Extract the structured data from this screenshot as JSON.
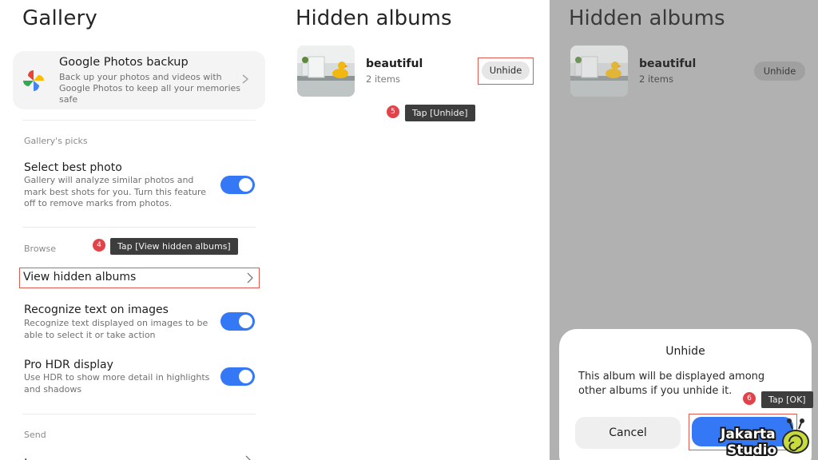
{
  "panel1": {
    "title": "Gallery",
    "backup": {
      "title": "Google Photos backup",
      "desc": "Back up your photos and videos with Google Photos to keep all your memories safe"
    },
    "picks_label": "Gallery's picks",
    "best_photo": {
      "title": "Select best photo",
      "desc": "Gallery will analyze similar photos and mark best shots for you. Turn this feature off to remove marks from photos.",
      "enabled": true
    },
    "browse_label": "Browse",
    "view_hidden": "View hidden albums",
    "recognize": {
      "title": "Recognize text on images",
      "desc": "Recognize text displayed on images to be able to select it or take action",
      "enabled": true
    },
    "hdr": {
      "title": "Pro HDR display",
      "desc": "Use HDR to show more detail in highlights and shadows",
      "enabled": true
    },
    "send_label": "Send",
    "step": "4",
    "tooltip": "Tap [View hidden albums]"
  },
  "panel2": {
    "title": "Hidden albums",
    "album": {
      "name": "beautiful",
      "count": "2 items"
    },
    "unhide": "Unhide",
    "step": "5",
    "tooltip": "Tap [Unhide]"
  },
  "panel3": {
    "title": "Hidden albums",
    "album": {
      "name": "beautiful",
      "count": "2 items"
    },
    "unhide": "Unhide",
    "dialog": {
      "title": "Unhide",
      "message": "This album will be displayed among other albums if you unhide it.",
      "cancel": "Cancel"
    },
    "step": "6",
    "tooltip": "Tap [OK]"
  },
  "watermark": {
    "line1": "Jakarta",
    "line2": "Studio"
  },
  "colors": {
    "accent": "#3478f6",
    "highlight": "#e05a4f",
    "badge": "#e2434b",
    "tooltip_bg": "#3d3d3d",
    "dim": "#b1b1b1"
  }
}
